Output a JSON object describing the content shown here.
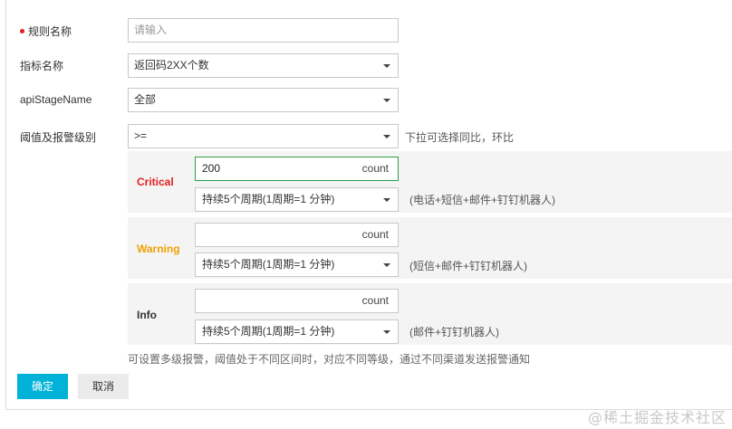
{
  "form": {
    "rule_name": {
      "label": "规则名称",
      "placeholder": "请输入"
    },
    "metric_name": {
      "label": "指标名称",
      "value": "返回码2XX个数"
    },
    "api_stage": {
      "label": "apiStageName",
      "value": "全部"
    },
    "threshold": {
      "label": "阈值及报警级别",
      "operator": ">=",
      "hint": "下拉可选择同比，环比"
    },
    "levels": [
      {
        "name": "Critical",
        "color": "#e02020",
        "count_value": "200",
        "unit": "count",
        "duration": "持续5个周期(1周期=1 分钟)",
        "channels": "(电话+短信+邮件+钉钉机器人)"
      },
      {
        "name": "Warning",
        "color": "#f0a000",
        "count_value": "",
        "unit": "count",
        "duration": "持续5个周期(1周期=1 分钟)",
        "channels": "(短信+邮件+钉钉机器人)"
      },
      {
        "name": "Info",
        "color": "#333333",
        "count_value": "",
        "unit": "count",
        "duration": "持续5个周期(1周期=1 分钟)",
        "channels": "(邮件+钉钉机器人)"
      }
    ],
    "footnote": "可设置多级报警，阈值处于不同区间时，对应不同等级，通过不同渠道发送报警通知",
    "buttons": {
      "confirm": "确定",
      "cancel": "取消"
    }
  },
  "watermark": "@稀土掘金技术社区"
}
